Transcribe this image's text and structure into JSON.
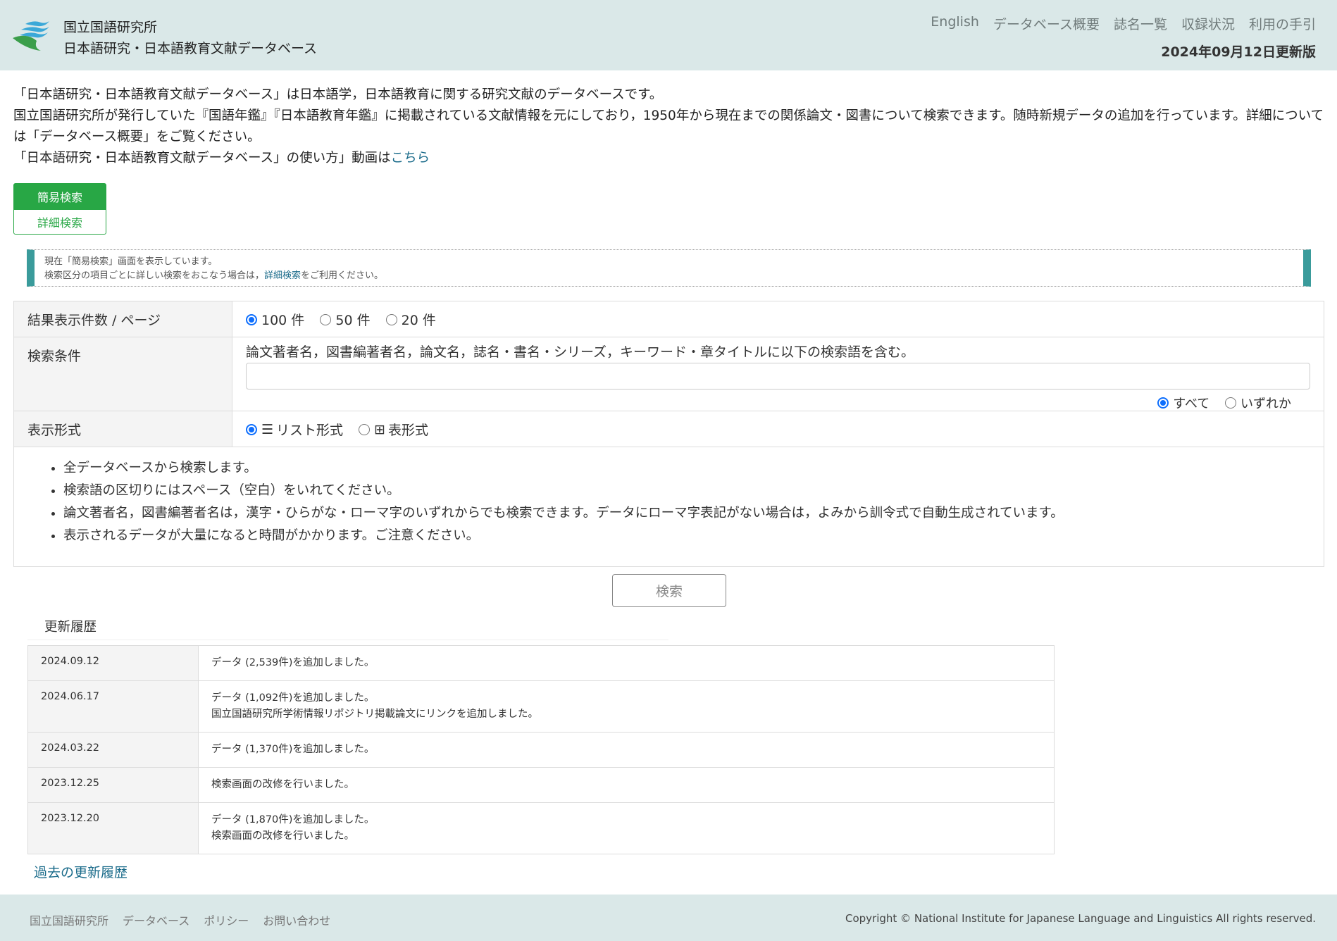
{
  "header": {
    "org": "国立国語研究所",
    "title": "日本語研究・日本語教育文献データベース",
    "nav": [
      "English",
      "データベース概要",
      "誌名一覧",
      "収録状況",
      "利用の手引"
    ],
    "updated": "2024年09月12日更新版"
  },
  "intro": {
    "line1": "「日本語研究・日本語教育文献データベース」は日本語学，日本語教育に関する研究文献のデータベースです。",
    "line2": "国立国語研究所が発行していた『国語年鑑』『日本語教育年鑑』に掲載されている文献情報を元にしており，1950年から現在までの関係論文・図書について検索できます。随時新規データの追加を行っています。詳細については「データベース概要」をご覧ください。",
    "line3": "「日本語研究・日本語教育文献データベース」の使い方」動画は",
    "link": "こちら"
  },
  "tabs": {
    "simple": "簡易検索",
    "advanced": "詳細検索"
  },
  "notice": {
    "line1": "現在「簡易検索」画面を表示しています。",
    "line2a": "検索区分の項目ごとに詳しい検索をおこなう場合は，",
    "link": "詳細検索",
    "line2b": "をご利用ください。"
  },
  "form": {
    "per_page": {
      "label": "結果表示件数 / ページ",
      "options": [
        "100 件",
        "50 件",
        "20 件"
      ],
      "selected": "100 件"
    },
    "condition": {
      "label": "検索条件",
      "desc": "論文著者名，図書編著者名，論文名，誌名・書名・シリーズ，キーワード・章タイトルに以下の検索語を含む。",
      "value": "",
      "scope": [
        "すべて",
        "いずれか"
      ],
      "scope_selected": "すべて"
    },
    "format": {
      "label": "表示形式",
      "options": [
        "リスト形式",
        "表形式"
      ],
      "selected": "リスト形式"
    },
    "notes": [
      "全データベースから検索します。",
      "検索語の区切りにはスペース（空白）をいれてください。",
      "論文著者名，図書編著者名は，漢字・ひらがな・ローマ字のいずれからでも検索できます。データにローマ字表記がない場合は，よみから訓令式で自動生成されています。",
      "表示されるデータが大量になると時間がかかります。ご注意ください。"
    ],
    "search_button": "検索"
  },
  "history": {
    "title": "更新履歴",
    "rows": [
      {
        "date": "2024.09.12",
        "lines": [
          "データ (2,539件)を追加しました。"
        ]
      },
      {
        "date": "2024.06.17",
        "lines": [
          "データ (1,092件)を追加しました。",
          "国立国語研究所学術情報リポジトリ掲載論文にリンクを追加しました。"
        ]
      },
      {
        "date": "2024.03.22",
        "lines": [
          "データ (1,370件)を追加しました。"
        ]
      },
      {
        "date": "2023.12.25",
        "lines": [
          "検索画面の改修を行いました。"
        ]
      },
      {
        "date": "2023.12.20",
        "lines": [
          "データ (1,870件)を追加しました。",
          "検索画面の改修を行いました。"
        ]
      }
    ],
    "past_link": "過去の更新履歴"
  },
  "footer": {
    "links": [
      "国立国語研究所",
      "データベース",
      "ポリシー",
      "お問い合わせ"
    ],
    "copyright": "Copyright © National Institute for Japanese Language and Linguistics All rights reserved."
  },
  "colors": {
    "header_bg": "#dae8e8",
    "accent_green": "#28a745",
    "notice_bar": "#3a9b9b",
    "link": "#1a6b8a"
  }
}
